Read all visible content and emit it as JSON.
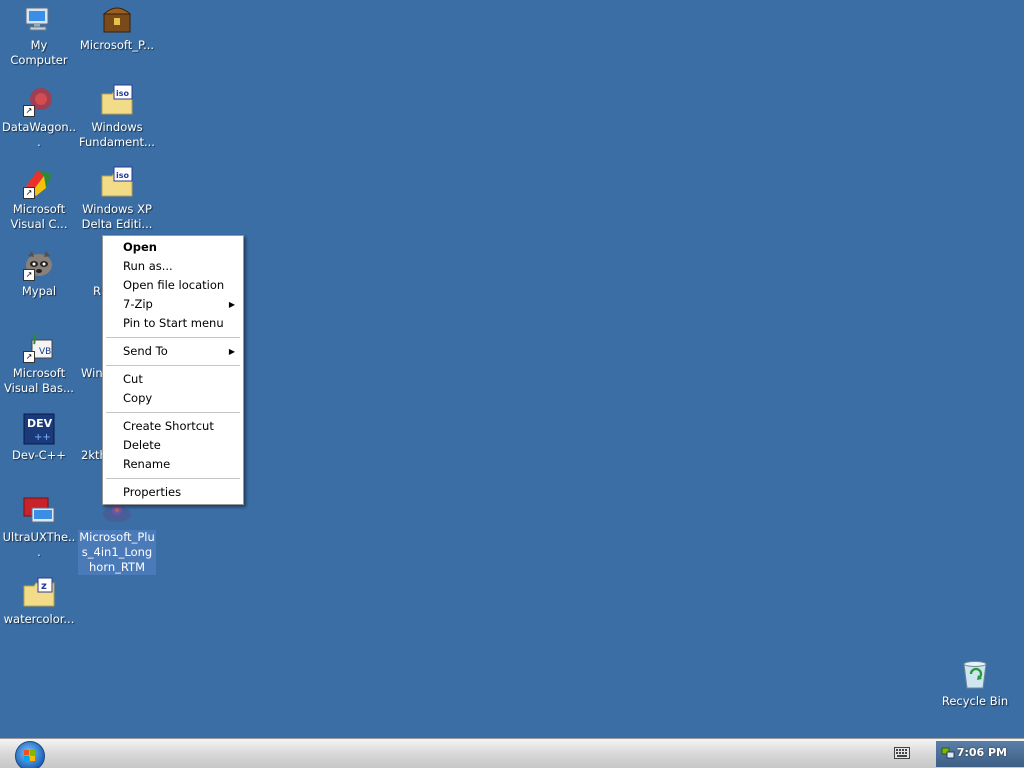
{
  "desktop": {
    "icons": [
      {
        "label": "My Computer",
        "icon": "computer-icon"
      },
      {
        "label": "Microsoft_P...",
        "icon": "treasure-chest-icon"
      },
      {
        "label": "DataWagon...",
        "icon": "datawagon-icon"
      },
      {
        "label": "Windows Fundament...",
        "icon": "iso-folder-icon"
      },
      {
        "label": "Microsoft Visual C...",
        "icon": "visual-cpp-icon"
      },
      {
        "label": "Windows XP Delta Editi...",
        "icon": "iso-folder-icon"
      },
      {
        "label": "Mypal",
        "icon": "raccoon-icon"
      },
      {
        "label": "R",
        "icon": "partial-icon"
      },
      {
        "label": "Microsoft Visual Bas...",
        "icon": "visual-basic-icon"
      },
      {
        "label": "Win",
        "icon": "partial-icon"
      },
      {
        "label": "Dev-C++",
        "icon": "dev-cpp-icon",
        "badge": "DEV"
      },
      {
        "label": "2kth",
        "icon": "partial-icon"
      },
      {
        "label": "UltraUXThe...",
        "icon": "ultraux-icon"
      },
      {
        "label": "Microsoft_Plus_4in1_Longhorn_RTM",
        "icon": "plus-package-icon"
      },
      {
        "label": "watercolor...",
        "icon": "zip-folder-icon"
      },
      {
        "label": "Recycle Bin",
        "icon": "recycle-bin-icon"
      }
    ]
  },
  "context_menu": {
    "items": [
      {
        "label": "Open",
        "bold": true
      },
      {
        "label": "Run as..."
      },
      {
        "label": "Open file location"
      },
      {
        "label": "7-Zip",
        "submenu": true
      },
      {
        "label": "Pin to Start menu"
      },
      {
        "label": "Send To",
        "submenu": true
      },
      {
        "label": "Cut"
      },
      {
        "label": "Copy"
      },
      {
        "label": "Create Shortcut"
      },
      {
        "label": "Delete"
      },
      {
        "label": "Rename"
      },
      {
        "label": "Properties"
      }
    ]
  },
  "taskbar": {
    "clock": "7:06 PM"
  },
  "colors": {
    "desktop": "#3a6ea5",
    "selection": "#4a7ab8",
    "menu_bg": "#ffffff"
  }
}
